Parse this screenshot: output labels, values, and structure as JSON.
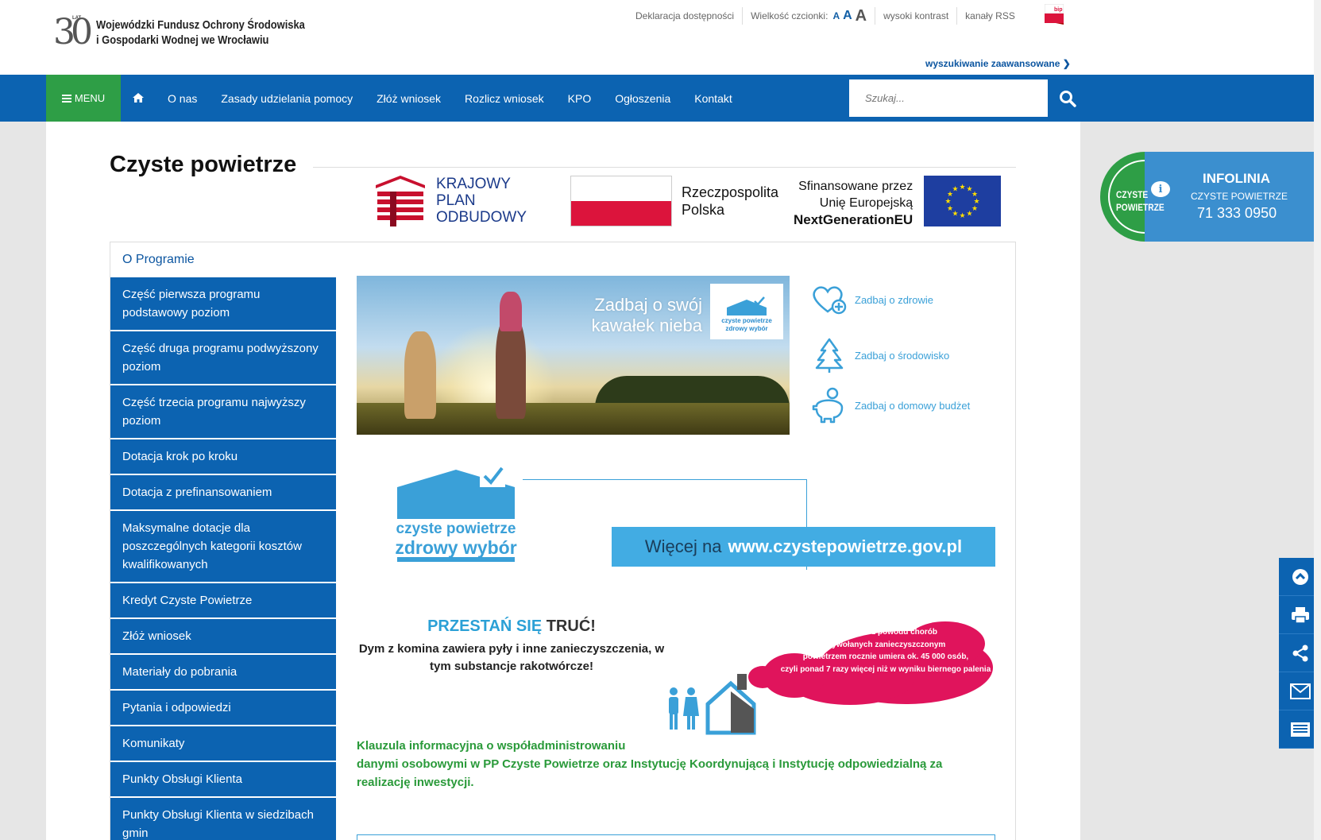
{
  "header": {
    "logo_num": "30",
    "logo_lat": "LAT",
    "logo_line1": "Wojewódzki Fundusz Ochrony Środowiska",
    "logo_line2": "i Gospodarki Wodnej we Wrocławiu",
    "util": {
      "accessibility": "Deklaracja dostępności",
      "font_size_label": "Wielkość czcionki:",
      "font_a": "A",
      "high_contrast": "wysoki kontrast",
      "rss": "kanały RSS",
      "bip": "bip"
    },
    "advanced_search": "wyszukiwanie zaawansowane"
  },
  "nav": {
    "menu_label": "MENU",
    "items": [
      "O nas",
      "Zasady udzielania pomocy",
      "Złóż wniosek",
      "Rozlicz wniosek",
      "KPO",
      "Ogłoszenia",
      "Kontakt"
    ],
    "search_placeholder": "Szukaj..."
  },
  "main": {
    "title": "Czyste powietrze",
    "kpo": {
      "kpo_l1": "KRAJOWY",
      "kpo_l2": "PLAN",
      "kpo_l3": "ODBUDOWY",
      "rp_l1": "Rzeczpospolita",
      "rp_l2": "Polska",
      "eu_l1": "Sfinansowane przez",
      "eu_l2": "Unię Europejską",
      "eu_l3": "NextGenerationEU"
    },
    "sidemenu": {
      "head": "O Programie",
      "items": [
        "Część pierwsza programu podstawowy poziom",
        "Część druga programu podwyższony poziom",
        "Część trzecia programu najwyższy poziom",
        "Dotacja krok po kroku",
        "Dotacja z prefinansowaniem",
        "Maksymalne dotacje dla poszczególnych kategorii kosztów kwalifikowanych",
        "Kredyt Czyste Powietrze",
        "Złóż wniosek",
        "Materiały do pobrania",
        "Pytania i odpowiedzi",
        "Komunikaty",
        "Punkty Obsługi Klienta",
        "Punkty Obsługi Klienta w siedzibach gmin"
      ]
    },
    "hero": {
      "caption_l1": "Zadbaj o swój",
      "caption_l2": "kawałek nieba",
      "badge_l1": "czyste powietrze",
      "badge_l2": "zdrowy wybór"
    },
    "care": [
      "Zadbaj o zdrowie",
      "Zadbaj o środowisko",
      "Zadbaj o domowy budżet"
    ],
    "cp_logo": {
      "l1": "czyste powietrze",
      "l2": "zdrowy wybór"
    },
    "more": {
      "pre": "Więcej na",
      "url": "www.czystepowietrze.gov.pl"
    },
    "przestan": {
      "h1": "PRZESTAŃ SIĘ",
      "h2": "TRUĆ!",
      "p": "Dym z komina zawiera pyły i inne zanieczyszczenia, w tym substancje rakotwórcze!"
    },
    "cloud": {
      "l1": "W Polsce z powodu chorób",
      "l2": "wywołanych zanieczyszczonym",
      "l3": "powietrzem rocznie umiera ok. 45 000 osób,",
      "l4": "czyli ponad 7 razy więcej niż w wyniku biernego palenia"
    },
    "klauzula_l1": "Klauzula informacyjna o współadministrowaniu",
    "klauzula_l2": "danymi osobowymi w PP Czyste Powietrze oraz Instytucję Koordynującą i Instytucję odpowiedzialną za realizację inwestycji."
  },
  "infolinia": {
    "circle_l1": "CZYSTE",
    "circle_l2": "POWIETRZE",
    "title": "INFOLINIA",
    "subtitle": "CZYSTE POWIETRZE",
    "phone": "71 333 0950"
  },
  "colors": {
    "nav_blue": "#0c63b1",
    "menu_green": "#2e9e46",
    "light_blue": "#42ace3",
    "klauzula_green": "#2a9a3a",
    "cloud_pink": "#e0145c"
  }
}
